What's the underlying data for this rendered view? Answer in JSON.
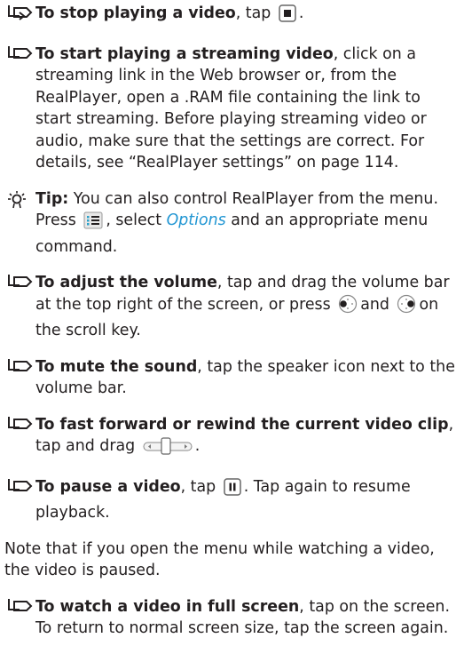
{
  "items": [
    {
      "bold": "To stop playing a video",
      "text_a": ", tap",
      "text_b": "."
    },
    {
      "bold": "To start playing a streaming video",
      "text": ", click on a streaming link in the Web browser or, from the RealPlayer, open a .RAM file containing the link to start streaming. Before playing streaming video or audio, make sure that the settings are correct. For details, see “RealPlayer settings” on page 114."
    },
    {
      "bold": "Tip:",
      "text_a": " You can also control RealPlayer from the menu. Press",
      "text_b": ", select",
      "italic": "Options",
      "text_c": " and an appropriate menu command."
    },
    {
      "bold": "To adjust the volume",
      "text_a": ", tap and drag the volume bar at the top right of the screen, or press",
      "text_b": "and",
      "text_c": "on the scroll key."
    },
    {
      "bold": "To mute the sound",
      "text": ", tap the speaker icon next to the volume bar."
    },
    {
      "bold": "To fast forward or rewind the current video clip",
      "text_a": ", tap and drag",
      "text_b": "."
    },
    {
      "bold": "To pause a video",
      "text_a": ", tap",
      "text_b": ". Tap again to resume playback."
    },
    {
      "text": "Note that if you open the menu while watching a video, the video is paused."
    },
    {
      "bold": "To watch a video in full screen",
      "text": ", tap on the screen. To return to normal screen size, tap the screen again."
    }
  ],
  "icons": {
    "marker": "arrow-marker-icon",
    "stop": "stop-button-icon",
    "menu": "menu-key-icon",
    "scroll_left": "scroll-left-icon",
    "scroll_right": "scroll-right-icon",
    "slider": "progress-slider-icon",
    "pause": "pause-button-icon",
    "tip": "tip-lightbulb-icon"
  },
  "colors": {
    "text": "#231f20",
    "italic": "#2196d3"
  }
}
